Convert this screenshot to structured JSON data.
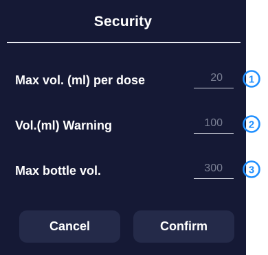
{
  "dialog": {
    "title": "Security",
    "settings": [
      {
        "label": "Max vol. (ml) per dose",
        "value": "20",
        "index": "1"
      },
      {
        "label": "Vol.(ml) Warning",
        "value": "100",
        "index": "2"
      },
      {
        "label": "Max bottle vol.",
        "value": "300",
        "index": "3"
      }
    ],
    "buttons": {
      "cancel": "Cancel",
      "confirm": "Confirm"
    }
  },
  "colors": {
    "background": "#151935",
    "button": "#242a49",
    "accent": "#1f8fff",
    "input_text": "#7a7f93",
    "divider": "#e9ebf2"
  }
}
